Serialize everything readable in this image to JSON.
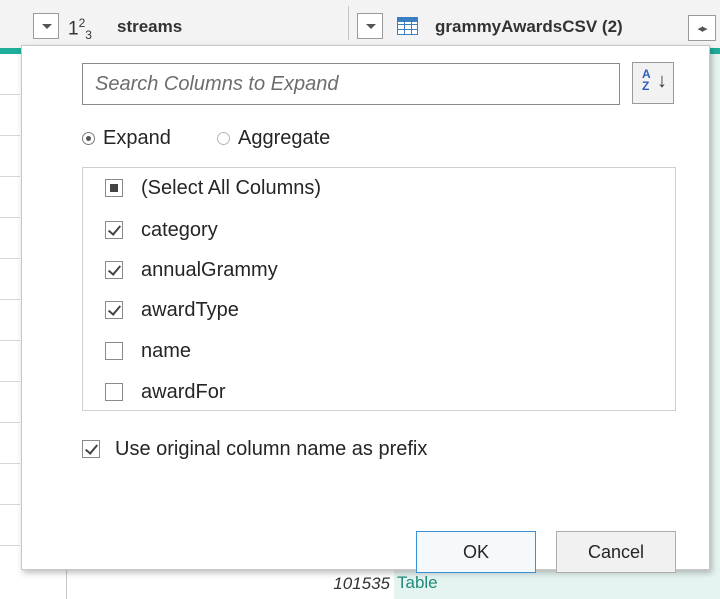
{
  "grid": {
    "column1": {
      "type_base": "1",
      "type_sup": "2",
      "type_sub": "3",
      "name": "streams"
    },
    "column2": {
      "name": "grammyAwardsCSV (2)"
    },
    "bottom_row": {
      "number": "101535",
      "table": "Table"
    }
  },
  "popup": {
    "search_placeholder": "Search Columns to Expand",
    "sort": {
      "az": "A\nZ",
      "arrow": "↓"
    },
    "modes": [
      {
        "label": "Expand",
        "selected": true
      },
      {
        "label": "Aggregate",
        "selected": false
      }
    ],
    "columns": [
      {
        "label": "(Select All Columns)",
        "state": "partial"
      },
      {
        "label": "category",
        "state": "checked"
      },
      {
        "label": "annualGrammy",
        "state": "checked"
      },
      {
        "label": "awardType",
        "state": "checked"
      },
      {
        "label": "name",
        "state": "unchecked"
      },
      {
        "label": "awardFor",
        "state": "unchecked"
      }
    ],
    "prefix": {
      "label": "Use original column name as prefix",
      "checked": true
    },
    "ok_label": "OK",
    "cancel_label": "Cancel"
  },
  "colors": {
    "accent_teal": "#1fae9a",
    "table_cell_bg": "#e5f4f1",
    "ok_border": "#3b8fd6"
  }
}
